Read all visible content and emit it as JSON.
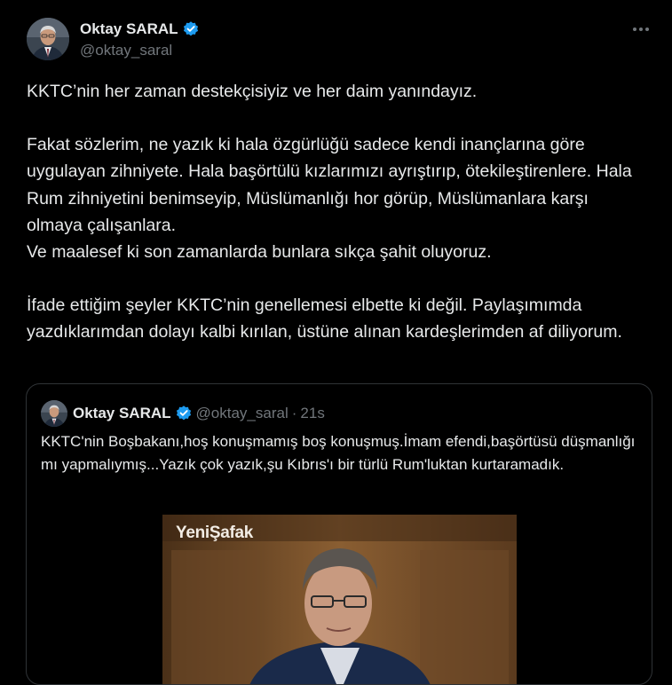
{
  "author": {
    "display_name": "Oktay SARAL",
    "handle": "@oktay_saral",
    "verified_icon": "verified-badge-icon",
    "verified_color": "#1d9bf0"
  },
  "more_icon": "more-options-icon",
  "tweet": {
    "paragraphs": [
      "KKTC’nin her zaman destekçisiyiz ve her daim yanındayız.",
      "Fakat sözlerim, ne yazık ki hala özgürlüğü sadece kendi inançlarına göre uygulayan zihniyete. Hala başörtülü kızlarımızı ayrıştırıp, ötekileştirenlere. Hala Rum zihniyetini benimseyip, Müslümanlığı hor görüp, Müslümanlara karşı olmaya çalışanlara.",
      "Ve maalesef ki son zamanlarda bunlara sıkça şahit oluyoruz.",
      "İfade ettiğim şeyler KKTC’nin genellemesi elbette ki değil. Paylaşımımda yazdıklarımdan dolayı kalbi kırılan, üstüne alınan kardeşlerimden af diliyorum."
    ]
  },
  "quote": {
    "display_name": "Oktay SARAL",
    "handle": "@oktay_saral",
    "separator": "·",
    "time": "21s",
    "text": "KKTC'nin Boşbakanı,hoş konuşmamış boş konuşmuş.İmam efendi,başörtüsü düşmanlığı mı yapmalıymış...Yazık çok yazık,şu Kıbrıs'ı bir türlü Rum'luktan kurtaramadık.",
    "media_watermark": "YeniŞafak"
  },
  "colors": {
    "background": "#000000",
    "text_primary": "#e7e9ea",
    "text_secondary": "#71767b",
    "border": "#2f3336",
    "accent": "#1d9bf0"
  }
}
